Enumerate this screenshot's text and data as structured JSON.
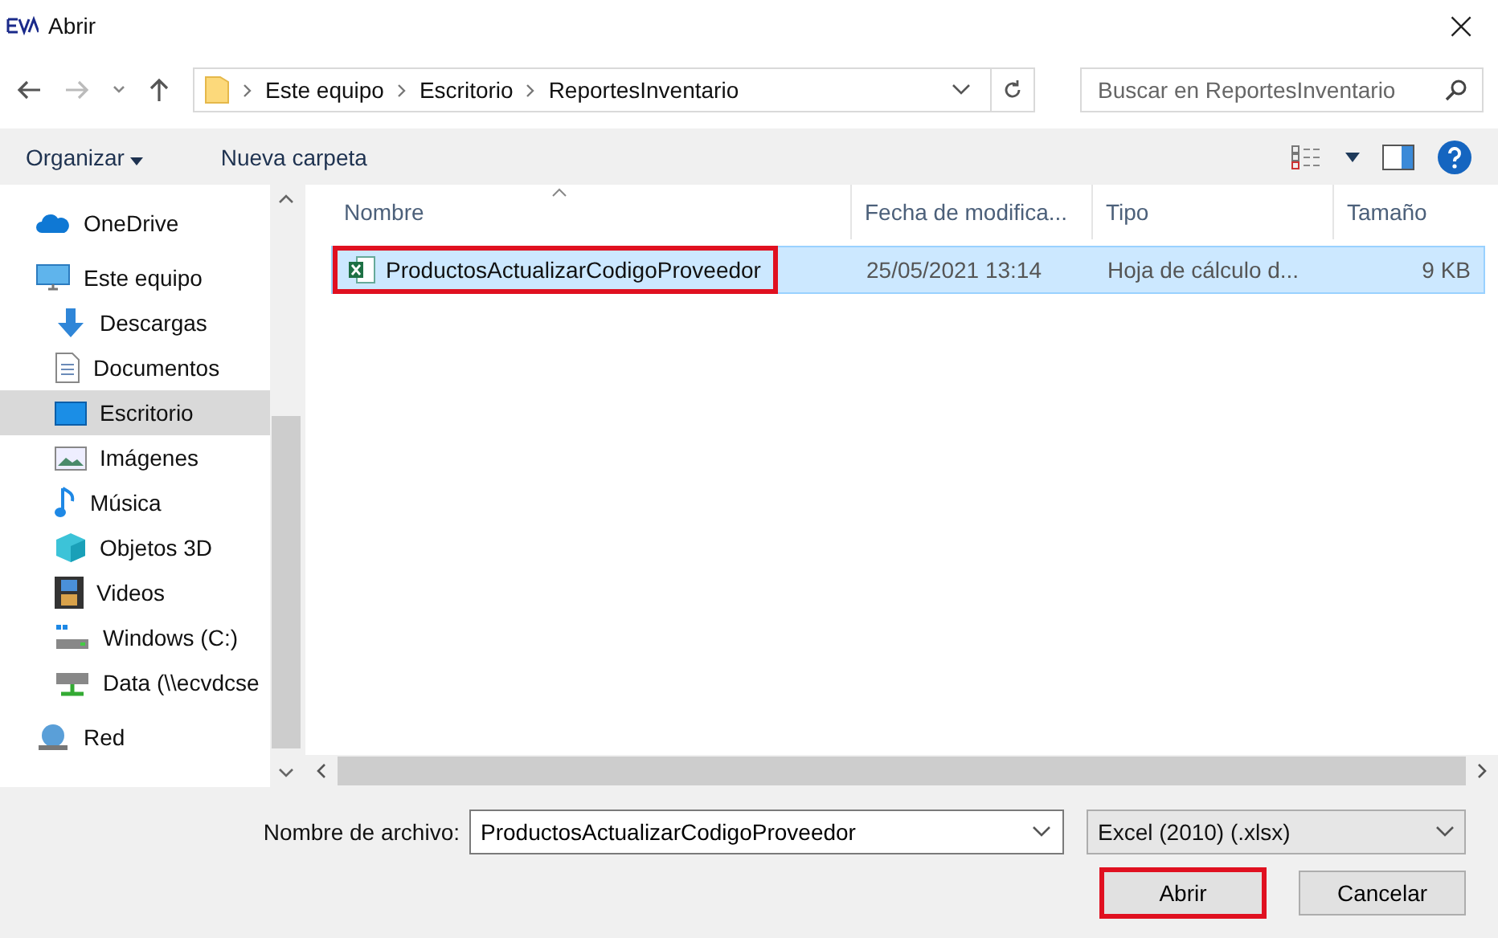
{
  "window": {
    "title": "Abrir",
    "close": "×"
  },
  "address": {
    "path": [
      "Este equipo",
      "Escritorio",
      "ReportesInventario"
    ]
  },
  "search": {
    "placeholder": "Buscar en ReportesInventario"
  },
  "toolbar": {
    "organize": "Organizar",
    "new_folder": "Nueva carpeta"
  },
  "sidebar": {
    "items": [
      {
        "label": "OneDrive",
        "kind": "cloud",
        "selected": false
      },
      {
        "label": "Este equipo",
        "kind": "computer",
        "selected": false,
        "children": [
          {
            "label": "Descargas",
            "kind": "download",
            "selected": false
          },
          {
            "label": "Documentos",
            "kind": "document",
            "selected": false
          },
          {
            "label": "Escritorio",
            "kind": "desktop",
            "selected": true
          },
          {
            "label": "Imágenes",
            "kind": "picture",
            "selected": false
          },
          {
            "label": "Música",
            "kind": "music",
            "selected": false
          },
          {
            "label": "Objetos 3D",
            "kind": "cube",
            "selected": false
          },
          {
            "label": "Videos",
            "kind": "film",
            "selected": false
          },
          {
            "label": "Windows (C:)",
            "kind": "drive",
            "selected": false
          },
          {
            "label": "Data (\\\\ecvdcse",
            "kind": "netdrive",
            "selected": false
          }
        ]
      },
      {
        "label": "Red",
        "kind": "network",
        "selected": false
      }
    ]
  },
  "table": {
    "columns": [
      {
        "label": "Nombre",
        "sorted": true
      },
      {
        "label": "Fecha de modifica...",
        "sorted": false
      },
      {
        "label": "Tipo",
        "sorted": false
      },
      {
        "label": "Tamaño",
        "sorted": false
      }
    ],
    "rows": [
      {
        "name": "ProductosActualizarCodigoProveedor",
        "date": "25/05/2021 13:14",
        "type": "Hoja de cálculo d...",
        "size": "9 KB",
        "selected": true,
        "highlighted": true
      }
    ]
  },
  "footer": {
    "filename_label": "Nombre de archivo:",
    "filename": "ProductosActualizarCodigoProveedor",
    "filetype": "Excel (2010) (.xlsx)",
    "buttons": [
      {
        "label": "Abrir",
        "highlighted": true
      },
      {
        "label": "Cancelar",
        "highlighted": false
      }
    ]
  }
}
